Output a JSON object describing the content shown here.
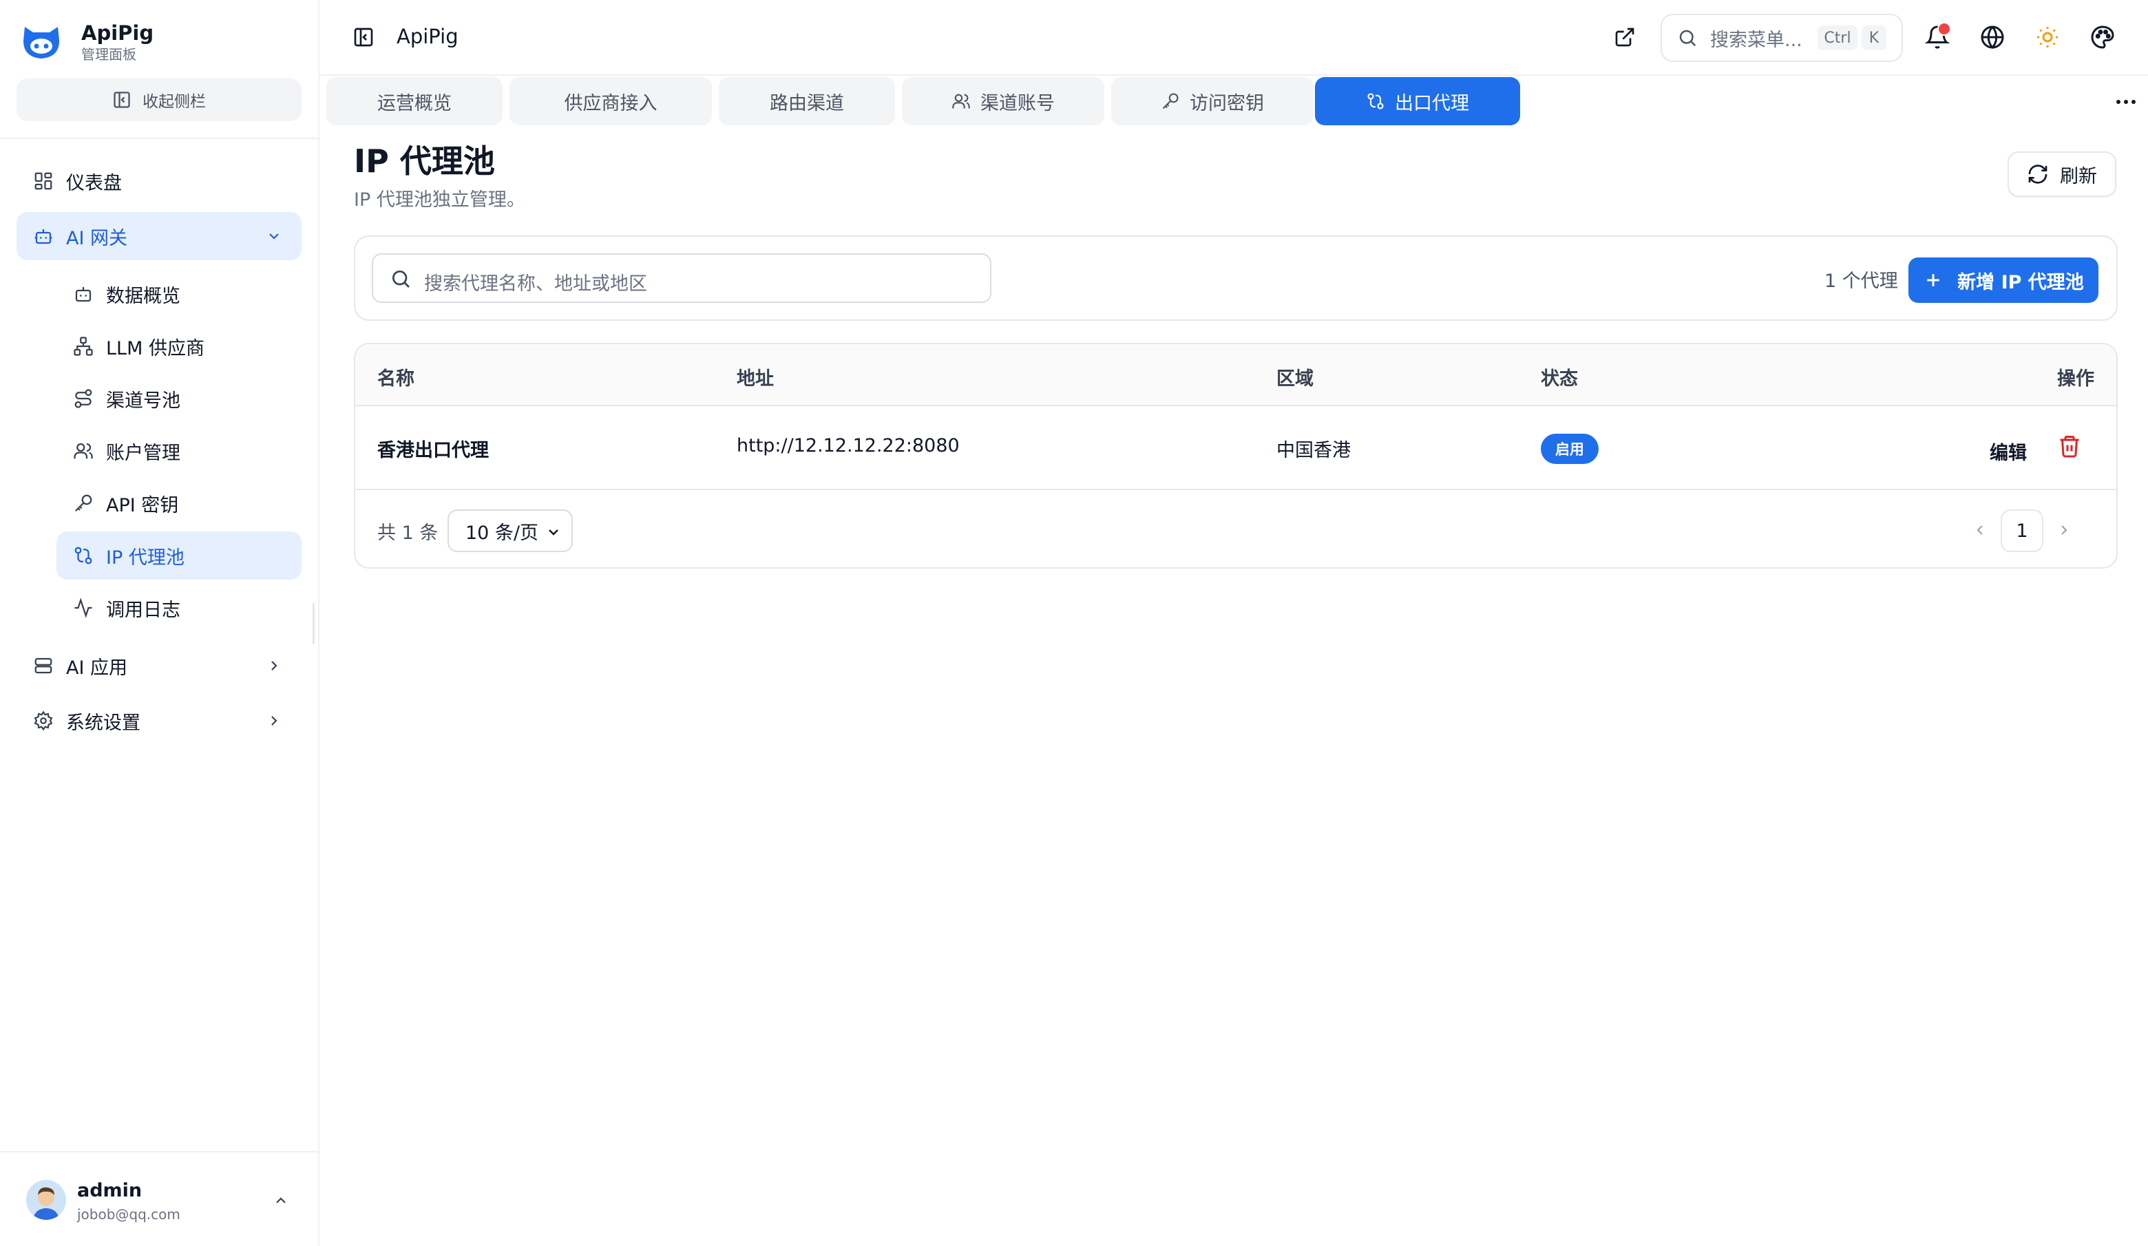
{
  "brand": {
    "name": "ApiPig",
    "subtitle": "管理面板"
  },
  "sidebar": {
    "collapse_label": "收起侧栏",
    "items": [
      {
        "label": "仪表盘",
        "icon": "dashboard-icon"
      },
      {
        "label": "AI 网关",
        "icon": "bot-icon",
        "expanded": true
      },
      {
        "label": "AI 应用",
        "icon": "apps-icon"
      },
      {
        "label": "系统设置",
        "icon": "gear-icon"
      }
    ],
    "sub_items": [
      {
        "label": "数据概览",
        "icon": "bot-icon"
      },
      {
        "label": "LLM 供应商",
        "icon": "network-icon"
      },
      {
        "label": "渠道号池",
        "icon": "route-icon"
      },
      {
        "label": "账户管理",
        "icon": "users-icon"
      },
      {
        "label": "API 密钥",
        "icon": "key-icon"
      },
      {
        "label": "IP 代理池",
        "icon": "proxy-icon",
        "active": true
      },
      {
        "label": "调用日志",
        "icon": "activity-icon"
      }
    ]
  },
  "user": {
    "name": "admin",
    "email": "jobob@qq.com"
  },
  "header": {
    "title": "ApiPig",
    "search_placeholder": "搜索菜单...",
    "kbd_ctrl": "Ctrl",
    "kbd_k": "K"
  },
  "tabs": [
    {
      "label": "运营概览"
    },
    {
      "label": "供应商接入"
    },
    {
      "label": "路由渠道"
    },
    {
      "label": "渠道账号",
      "icon": "users-icon"
    },
    {
      "label": "访问密钥",
      "icon": "key-icon"
    },
    {
      "label": "出口代理",
      "icon": "proxy-icon",
      "active": true
    }
  ],
  "page": {
    "title": "IP 代理池",
    "subtitle": "IP 代理池独立管理。",
    "refresh_label": "刷新"
  },
  "filter": {
    "placeholder": "搜索代理名称、地址或地区",
    "count_text": "1 个代理",
    "add_label": "新增 IP 代理池"
  },
  "table": {
    "headers": {
      "name": "名称",
      "address": "地址",
      "region": "区域",
      "status": "状态",
      "actions": "操作"
    },
    "rows": [
      {
        "name": "香港出口代理",
        "address": "http://12.12.12.22:8080",
        "region": "中国香港",
        "status": "启用",
        "edit": "编辑"
      }
    ]
  },
  "pagination": {
    "total": "共 1 条",
    "page_size": "10 条/页",
    "current": "1"
  },
  "colors": {
    "primary": "#1f6feb",
    "active_bg": "#e6effd",
    "danger": "#dc2626",
    "notify": "#ef4444",
    "sun": "#f59e0b"
  }
}
